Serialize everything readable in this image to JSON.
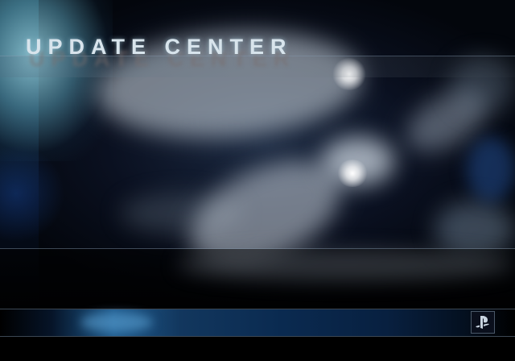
{
  "screen": {
    "title": "UPDATE CENTER"
  },
  "logo": {
    "icon": "playstation-logo-icon"
  },
  "colors": {
    "background": "#03060c",
    "title_text": "#d8e4ec",
    "accent_blue": "#1e5a8c",
    "glow_cyan": "#96d2e1"
  }
}
